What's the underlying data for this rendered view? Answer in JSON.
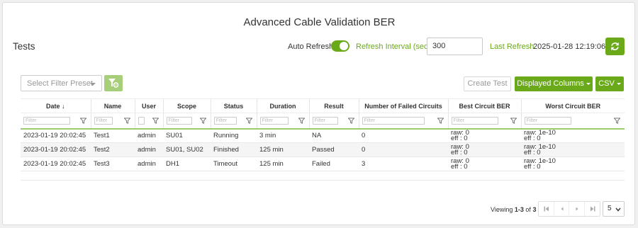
{
  "page": {
    "title": "Advanced Cable Validation BER",
    "section_label": "Tests"
  },
  "refresh": {
    "auto_refresh_label": "Auto Refresh",
    "auto_refresh_on": true,
    "interval_label": "Refresh Interval (sec)",
    "interval_value": "300",
    "last_refresh_label": "Last Refresh",
    "last_refresh_value": "2025-01-28 12:19:06",
    "refresh_icon": "refresh-icon"
  },
  "toolbar": {
    "preset_placeholder": "Select Filter Preset",
    "preset_icon": "filter-settings-icon",
    "create_test_label": "Create Test",
    "displayed_columns_label": "Displayed Columns",
    "csv_label": "CSV"
  },
  "table": {
    "columns": [
      {
        "label": "Date",
        "sort": "desc"
      },
      {
        "label": "Name"
      },
      {
        "label": "User"
      },
      {
        "label": "Scope"
      },
      {
        "label": "Status"
      },
      {
        "label": "Duration"
      },
      {
        "label": "Result"
      },
      {
        "label": "Number of Failed Circuits"
      },
      {
        "label": "Best Circuit BER"
      },
      {
        "label": "Worst Circuit BER"
      }
    ],
    "filter_placeholder": "Filter",
    "rows": [
      {
        "date": "2023-01-19 20:02:45",
        "name": "Test1",
        "user": "admin",
        "scope": "SU01",
        "status": "Running",
        "duration": "3 min",
        "result": "NA",
        "failed": "0",
        "best_raw": "raw: 0",
        "best_eff": "eff : 0",
        "worst_raw": "raw: 1e-10",
        "worst_eff": "eff : 0"
      },
      {
        "date": "2023-01-19 20:02:45",
        "name": "Test2",
        "user": "admin",
        "scope": "SU01, SU02",
        "status": "Finished",
        "duration": "125 min",
        "result": "Passed",
        "failed": "0",
        "best_raw": "raw: 0",
        "best_eff": "eff : 0",
        "worst_raw": "raw: 1e-10",
        "worst_eff": "eff : 0"
      },
      {
        "date": "2023-01-19 20:02:45",
        "name": "Test3",
        "user": "admin",
        "scope": "DH1",
        "status": "Timeout",
        "duration": "125 min",
        "result": "Failed",
        "failed": "3",
        "best_raw": "raw: 0",
        "best_eff": "eff : 0",
        "worst_raw": "raw: 1e-10",
        "worst_eff": "eff : 0"
      }
    ]
  },
  "pagination": {
    "viewing_prefix": "Viewing",
    "viewing_range": "1-3",
    "viewing_of": "of",
    "viewing_total": "3",
    "page_size": "5"
  },
  "colors": {
    "accent": "#6aaa1a",
    "accent_light": "#a7cf7a"
  }
}
